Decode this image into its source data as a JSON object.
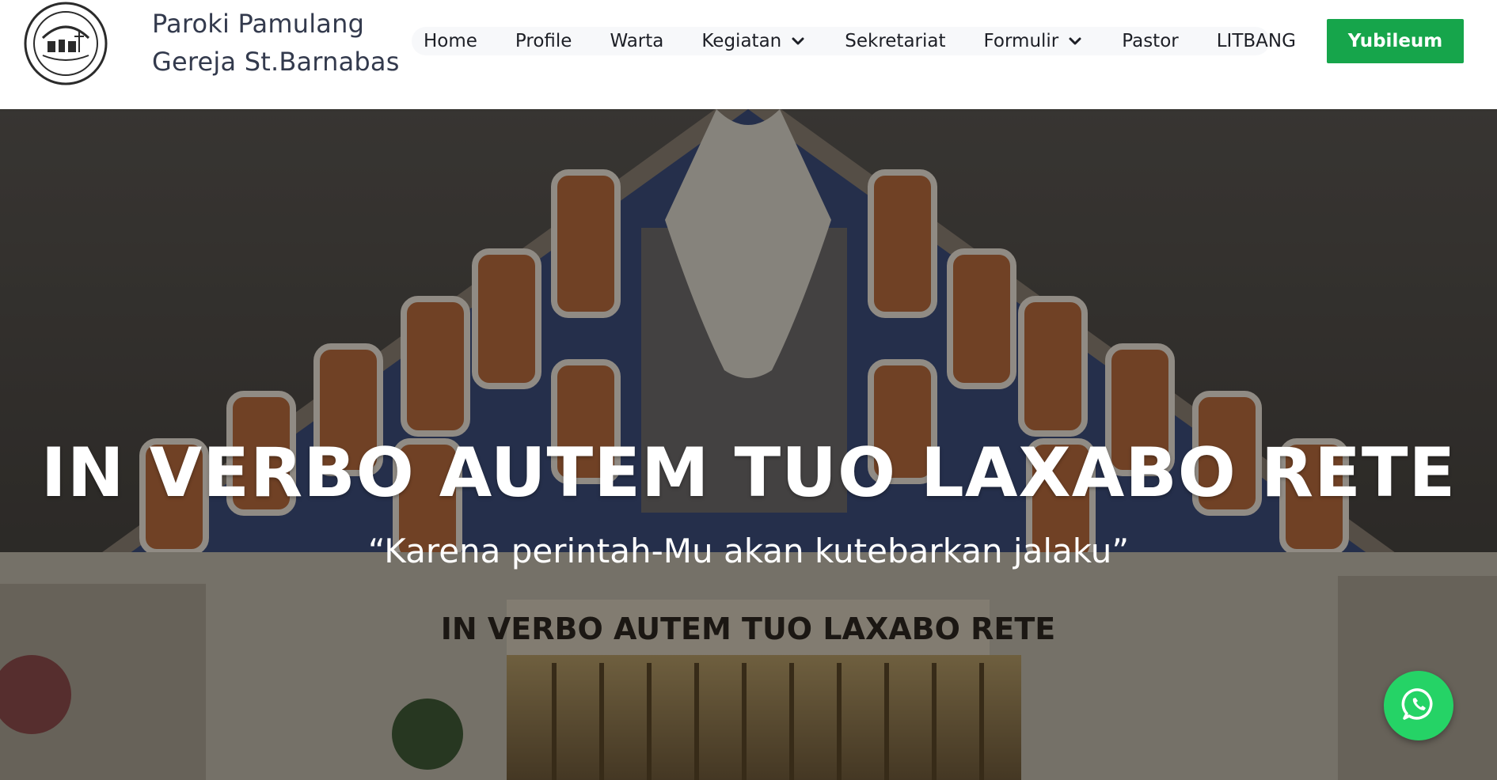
{
  "header": {
    "brand_line1": "Paroki Pamulang",
    "brand_line2": "Gereja St.Barnabas",
    "logo_icon": "parish-seal-logo",
    "nav": [
      {
        "label": "Home"
      },
      {
        "label": "Profile"
      },
      {
        "label": "Warta"
      },
      {
        "label": "Kegiatan",
        "has_dropdown": true
      },
      {
        "label": "Sekretariat"
      },
      {
        "label": "Formulir",
        "has_dropdown": true
      },
      {
        "label": "Pastor"
      },
      {
        "label": "LITBANG"
      }
    ],
    "cta_label": "Yubileum",
    "cta_color": "#16a54b"
  },
  "hero": {
    "title": "IN VERBO AUTEM TUO LAXABO RETE",
    "subtitle": "“Karena perintah-Mu akan kutebarkan jalaku”",
    "background": "church-altar-stained-glass-photo"
  },
  "floating": {
    "whatsapp_icon": "whatsapp-icon",
    "whatsapp_color": "#25d366"
  }
}
